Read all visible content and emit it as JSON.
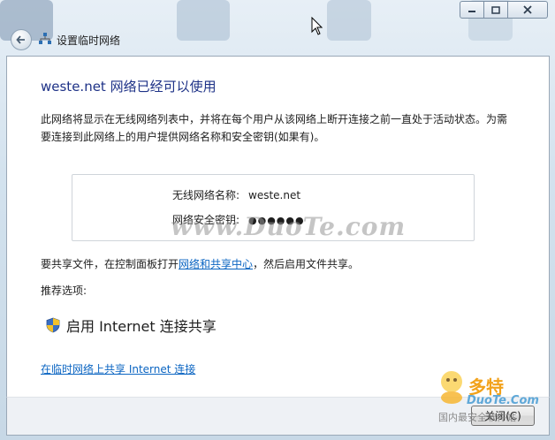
{
  "window": {
    "minimize_icon": "minimize-icon",
    "maximize_icon": "maximize-icon",
    "close_icon": "close-icon"
  },
  "header": {
    "title": "设置临时网络",
    "back_icon": "back-arrow-icon",
    "network_icon": "network-icon"
  },
  "content": {
    "heading": "weste.net 网络已经可以使用",
    "description": "此网络将显示在无线网络列表中，并将在每个用户从该网络上断开连接之前一直处于活动状态。为需要连接到此网络上的用户提供网络名称和安全密钥(如果有)。",
    "network_name_label": "无线网络名称:",
    "network_name_value": "weste.net",
    "security_key_label": "网络安全密钥:",
    "security_key_value": "●●●●●●",
    "share_prefix": "要共享文件，在控制面板打开",
    "share_link": "网络和共享中心",
    "share_suffix": "，然后启用文件共享。",
    "recommended_label": "推荐选项:",
    "enable_ics": "启用 Internet 连接共享",
    "bottom_link": "在临时网络上共享 Internet 连接"
  },
  "footer": {
    "close_button": "关闭(C)"
  },
  "watermark": {
    "text": "www.DuoTe.com"
  },
  "logo": {
    "title": "多特",
    "subtitle": "DuoTe.Com",
    "tagline": "国内最安全软件站"
  },
  "colors": {
    "heading": "#1e3287",
    "link": "#0b65c2"
  }
}
